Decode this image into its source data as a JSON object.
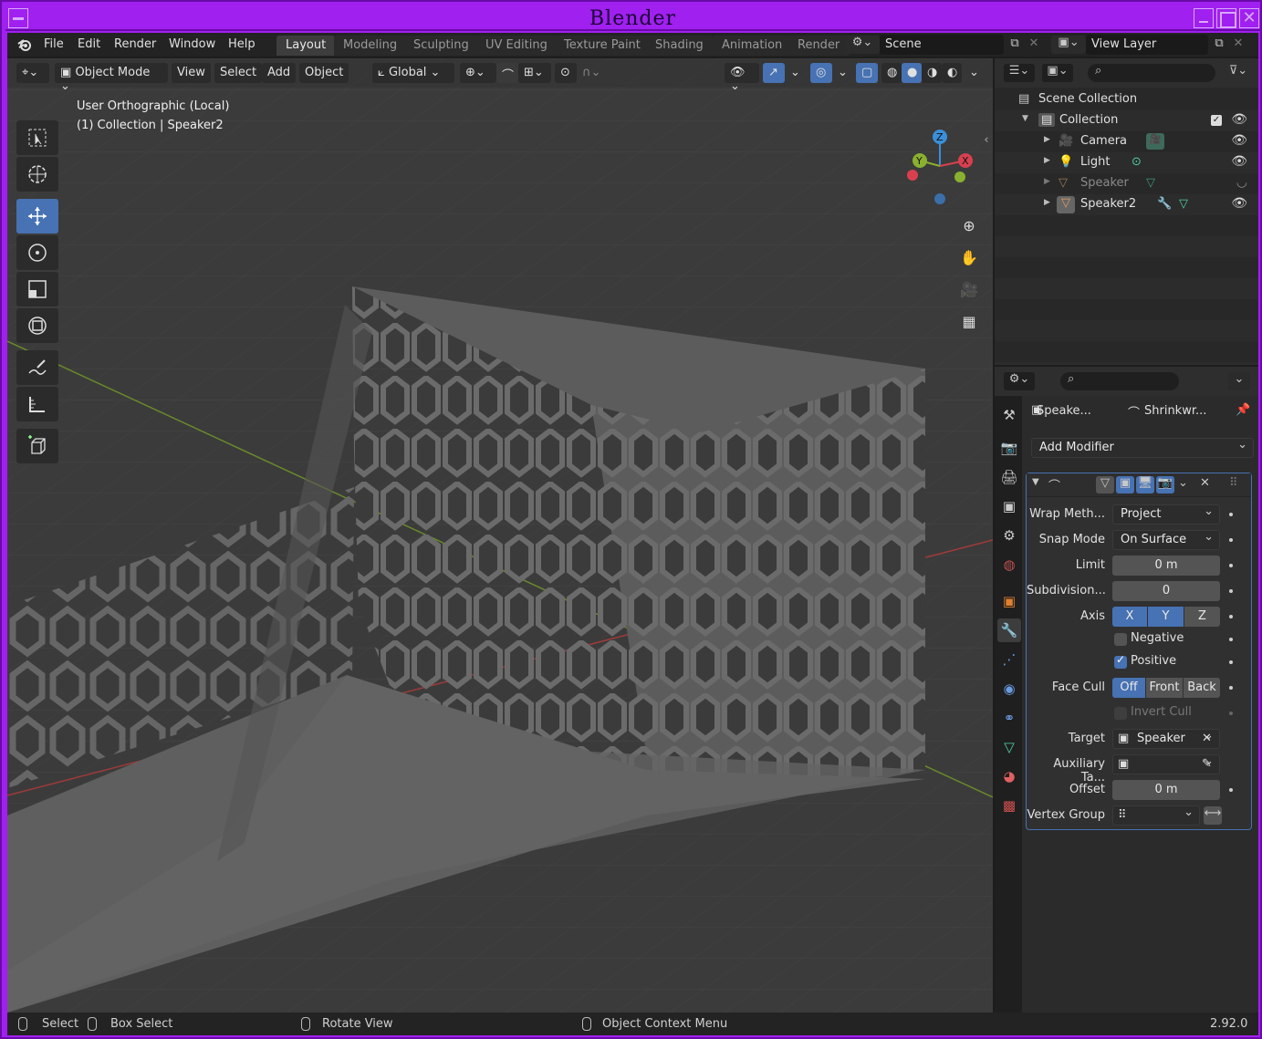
{
  "window": {
    "title": "Blender"
  },
  "topbar": {
    "menus": [
      "File",
      "Edit",
      "Render",
      "Window",
      "Help"
    ],
    "workspaces": [
      "Layout",
      "Modeling",
      "Sculpting",
      "UV Editing",
      "Texture Paint",
      "Shading",
      "Animation",
      "Render"
    ],
    "active_workspace": "Layout",
    "scene": "Scene",
    "view_layer": "View Layer"
  },
  "viewport": {
    "header": {
      "mode": "Object Mode",
      "menus": [
        "View",
        "Select",
        "Add",
        "Object"
      ],
      "transform_orientation": "Global"
    },
    "info_line1": "User Orthographic (Local)",
    "info_line2": "(1) Collection | Speaker2",
    "gizmo": {
      "x": "X",
      "y": "Y",
      "z": "Z"
    }
  },
  "outliner": {
    "root": "Scene Collection",
    "collection": "Collection",
    "items": [
      {
        "name": "Camera",
        "icon": "camera-icon",
        "color": "#e0a060",
        "visible": true
      },
      {
        "name": "Light",
        "icon": "light-icon",
        "color": "#e0a060",
        "visible": true
      },
      {
        "name": "Speaker",
        "icon": "speaker-icon",
        "color": "#e0a060",
        "visible": false
      },
      {
        "name": "Speaker2",
        "icon": "speaker-icon",
        "color": "#e0a060",
        "visible": true
      }
    ]
  },
  "properties": {
    "breadcrumb_object": "Speake...",
    "breadcrumb_modifier": "Shrinkwr...",
    "add_modifier": "Add Modifier",
    "modifier": {
      "wrap_method_label": "Wrap Meth...",
      "wrap_method": "Project",
      "snap_mode_label": "Snap Mode",
      "snap_mode": "On Surface",
      "limit_label": "Limit",
      "limit": "0 m",
      "subdivision_label": "Subdivision...",
      "subdivision": "0",
      "axis_label": "Axis",
      "axis": [
        "X",
        "Y",
        "Z"
      ],
      "negative_label": "Negative",
      "negative": false,
      "positive_label": "Positive",
      "positive": true,
      "face_cull_label": "Face Cull",
      "face_cull": [
        "Off",
        "Front",
        "Back"
      ],
      "invert_cull_label": "Invert Cull",
      "target_label": "Target",
      "target": "Speaker",
      "aux_target_label": "Auxiliary Ta...",
      "offset_label": "Offset",
      "offset": "0 m",
      "vertex_group_label": "Vertex Group"
    }
  },
  "status": {
    "select": "Select",
    "box_select": "Box Select",
    "rotate_view": "Rotate View",
    "context_menu": "Object Context Menu",
    "version": "2.92.0"
  }
}
